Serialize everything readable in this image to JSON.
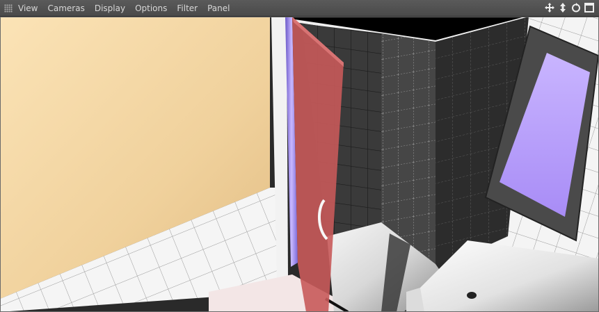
{
  "menu": {
    "items": [
      {
        "label": "View"
      },
      {
        "label": "Cameras"
      },
      {
        "label": "Display"
      },
      {
        "label": "Options"
      },
      {
        "label": "Filter"
      },
      {
        "label": "Panel"
      }
    ]
  },
  "nav_icons": [
    "move-icon",
    "zoom-icon",
    "rotate-icon",
    "maximize-icon"
  ],
  "colors": {
    "menubar": "#4e4e4e",
    "menu_text": "#d8d8d8",
    "wall_paint": "#f3d8a8",
    "shower_door": "#c85a5a",
    "mirror_glass": "#b79cff",
    "tile_dark": "#3a3a3a",
    "tile_white": "#f4f4f4"
  }
}
